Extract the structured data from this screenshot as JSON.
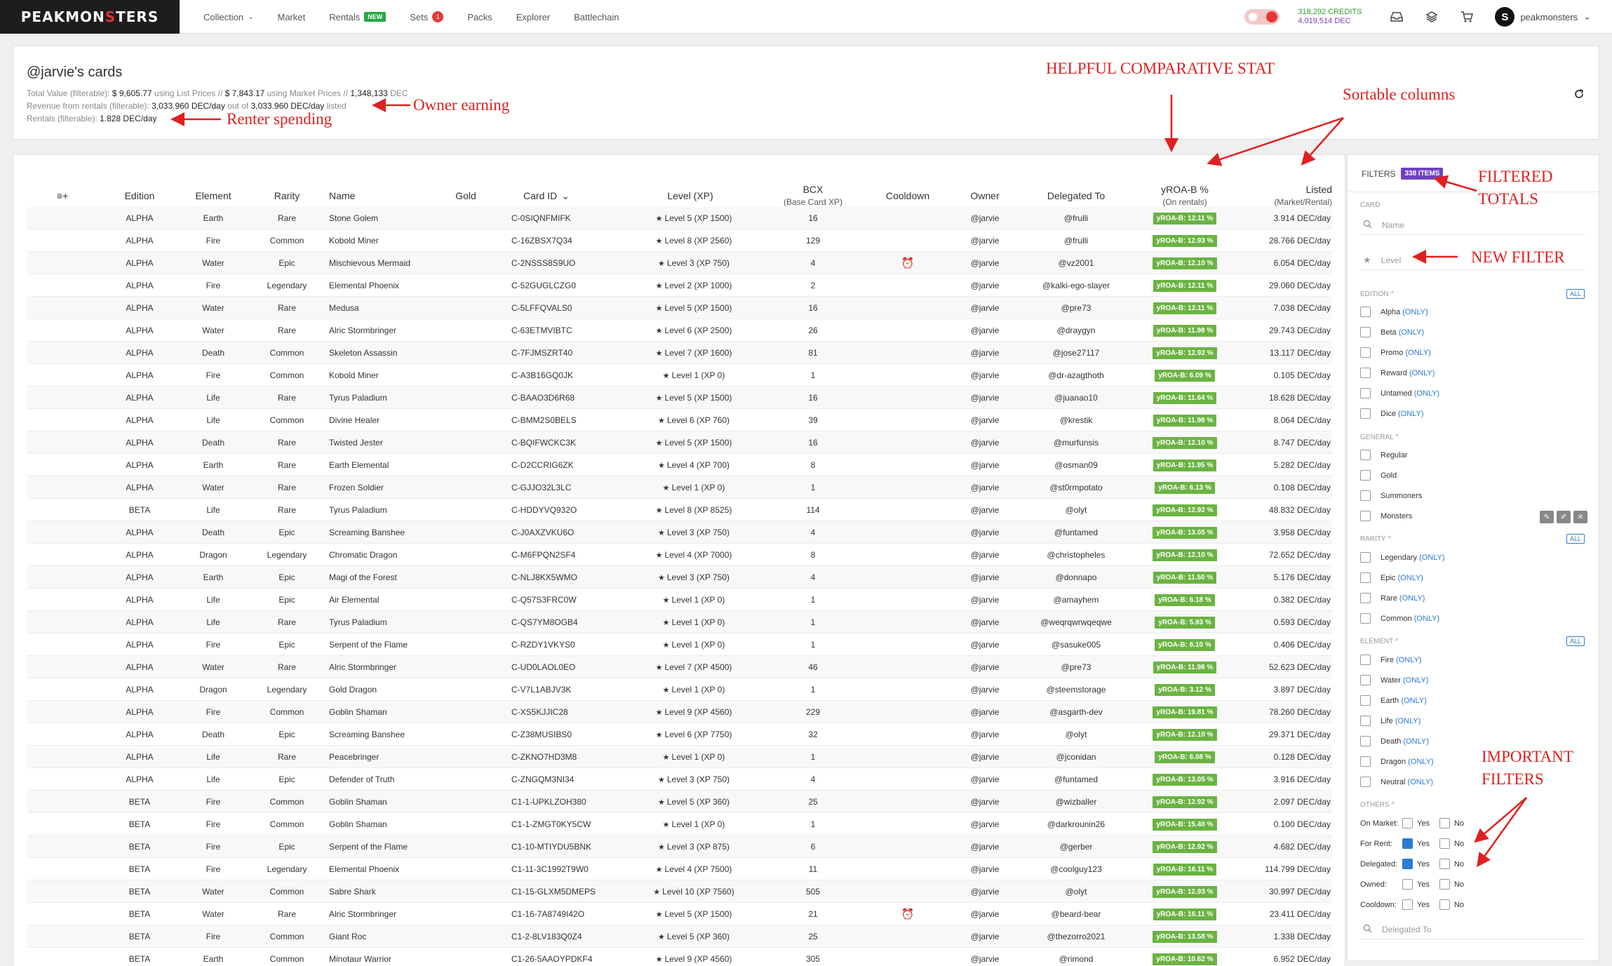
{
  "nav": {
    "logo_left": "PEAKMON",
    "logo_s": "S",
    "logo_right": "TERS",
    "menu": [
      {
        "label": "Collection",
        "caret": "⌄",
        "badge": "",
        "count": ""
      },
      {
        "label": "Market",
        "caret": "",
        "badge": "",
        "count": ""
      },
      {
        "label": "Rentals",
        "caret": "",
        "badge": "NEW",
        "count": ""
      },
      {
        "label": "Sets",
        "caret": "",
        "badge": "",
        "count": "1"
      },
      {
        "label": "Packs",
        "caret": "",
        "badge": "",
        "count": ""
      },
      {
        "label": "Explorer",
        "caret": "",
        "badge": "",
        "count": ""
      },
      {
        "label": "Battlechain",
        "caret": "",
        "badge": "",
        "count": ""
      }
    ],
    "credits": "318,292 CREDITS",
    "dec": "4,019,514 DEC",
    "username": "peakmonsters",
    "user_caret": "⌄",
    "icons": [
      "inbox-icon",
      "layers-icon",
      "cart-icon"
    ]
  },
  "header": {
    "title": "@jarvie's cards",
    "line1": {
      "p1": "Total Value (filterable):",
      "v1": "$ 9,605.77",
      "p2": "using List Prices //",
      "v2": "$ 7,843.17",
      "p3": "using Market Prices //",
      "v3": "1,348,133",
      "p4": "DEC"
    },
    "line2": {
      "p1": "Revenue from rentals (filterable):",
      "v1": "3,033.960 DEC/day",
      "p2": "out of",
      "v2": "3,033.960 DEC/day",
      "p3": "listed"
    },
    "line3": {
      "p1": "Rentals (filterable):",
      "v1": "1.828 DEC/day"
    }
  },
  "annotations": {
    "owner_earning": "Owner earning",
    "renter_spending": "Renter spending",
    "helpful": "HELPFUL COMPARATIVE STAT",
    "sortable": "Sortable columns",
    "filtered_totals_1": "FILTERED",
    "filtered_totals_2": "TOTALS",
    "new_filter": "NEW FILTER",
    "important_1": "IMPORTANT",
    "important_2": "FILTERS"
  },
  "table": {
    "columns": {
      "menu": "≡+",
      "edition": "Edition",
      "element": "Element",
      "rarity": "Rarity",
      "name": "Name",
      "gold": "Gold",
      "card_id": "Card ID",
      "card_id_sort": "⌄",
      "level": "Level (XP)",
      "bcx": "BCX",
      "bcx_sub": "(Base Card XP)",
      "cooldown": "Cooldown",
      "owner": "Owner",
      "delegated": "Delegated To",
      "yroa": "yROA-B %",
      "yroa_sub": "(On rentals)",
      "listed": "Listed",
      "listed_sub": "(Market/Rental)"
    },
    "rows": [
      {
        "edition": "ALPHA",
        "element": "Earth",
        "rarity": "Rare",
        "name": "Stone Golem",
        "id": "C-0SIQNFMIFK",
        "level": "Level 5 (XP 1500)",
        "bcx": "16",
        "cooldown": "",
        "owner": "@jarvie",
        "delegated": "@frulli",
        "roa": "yROA-B: 12.11 %",
        "listed": "3.914 DEC/day"
      },
      {
        "edition": "ALPHA",
        "element": "Fire",
        "rarity": "Common",
        "name": "Kobold Miner",
        "id": "C-16ZBSX7Q34",
        "level": "Level 8 (XP 2560)",
        "bcx": "129",
        "cooldown": "",
        "owner": "@jarvie",
        "delegated": "@frulli",
        "roa": "yROA-B: 12.93 %",
        "listed": "28.766 DEC/day"
      },
      {
        "edition": "ALPHA",
        "element": "Water",
        "rarity": "Epic",
        "name": "Mischievous Mermaid",
        "id": "C-2NSSS8S9UO",
        "level": "Level 3 (XP 750)",
        "bcx": "4",
        "cooldown": "⏰",
        "owner": "@jarvie",
        "delegated": "@vz2001",
        "roa": "yROA-B: 12.10 %",
        "listed": "6.054 DEC/day"
      },
      {
        "edition": "ALPHA",
        "element": "Fire",
        "rarity": "Legendary",
        "name": "Elemental Phoenix",
        "id": "C-52GUGLCZG0",
        "level": "Level 2 (XP 1000)",
        "bcx": "2",
        "cooldown": "",
        "owner": "@jarvie",
        "delegated": "@kalki-ego-slayer",
        "roa": "yROA-B: 12.11 %",
        "listed": "29.060 DEC/day"
      },
      {
        "edition": "ALPHA",
        "element": "Water",
        "rarity": "Rare",
        "name": "Medusa",
        "id": "C-5LFFQVALS0",
        "level": "Level 5 (XP 1500)",
        "bcx": "16",
        "cooldown": "",
        "owner": "@jarvie",
        "delegated": "@pre73",
        "roa": "yROA-B: 12.11 %",
        "listed": "7.038 DEC/day"
      },
      {
        "edition": "ALPHA",
        "element": "Water",
        "rarity": "Rare",
        "name": "Alric Stormbringer",
        "id": "C-63ETMVIBTC",
        "level": "Level 6 (XP 2500)",
        "bcx": "26",
        "cooldown": "",
        "owner": "@jarvie",
        "delegated": "@draygyn",
        "roa": "yROA-B: 11.98 %",
        "listed": "29.743 DEC/day"
      },
      {
        "edition": "ALPHA",
        "element": "Death",
        "rarity": "Common",
        "name": "Skeleton Assassin",
        "id": "C-7FJMSZRT40",
        "level": "Level 7 (XP 1600)",
        "bcx": "81",
        "cooldown": "",
        "owner": "@jarvie",
        "delegated": "@jose27117",
        "roa": "yROA-B: 12.92 %",
        "listed": "13.117 DEC/day"
      },
      {
        "edition": "ALPHA",
        "element": "Fire",
        "rarity": "Common",
        "name": "Kobold Miner",
        "id": "C-A3B16GQ0JK",
        "level": "Level 1 (XP 0)",
        "bcx": "1",
        "cooldown": "",
        "owner": "@jarvie",
        "delegated": "@dr-azagthoth",
        "roa": "yROA-B: 6.09 %",
        "listed": "0.105 DEC/day"
      },
      {
        "edition": "ALPHA",
        "element": "Life",
        "rarity": "Rare",
        "name": "Tyrus Paladium",
        "id": "C-BAAO3D6R68",
        "level": "Level 5 (XP 1500)",
        "bcx": "16",
        "cooldown": "",
        "owner": "@jarvie",
        "delegated": "@juanao10",
        "roa": "yROA-B: 11.64 %",
        "listed": "18.628 DEC/day"
      },
      {
        "edition": "ALPHA",
        "element": "Life",
        "rarity": "Common",
        "name": "Divine Healer",
        "id": "C-BMM2S0BELS",
        "level": "Level 6 (XP 760)",
        "bcx": "39",
        "cooldown": "",
        "owner": "@jarvie",
        "delegated": "@krestik",
        "roa": "yROA-B: 11.98 %",
        "listed": "8.064 DEC/day"
      },
      {
        "edition": "ALPHA",
        "element": "Death",
        "rarity": "Rare",
        "name": "Twisted Jester",
        "id": "C-BQIFWCKC3K",
        "level": "Level 5 (XP 1500)",
        "bcx": "16",
        "cooldown": "",
        "owner": "@jarvie",
        "delegated": "@murfunsis",
        "roa": "yROA-B: 12.10 %",
        "listed": "8.747 DEC/day"
      },
      {
        "edition": "ALPHA",
        "element": "Earth",
        "rarity": "Rare",
        "name": "Earth Elemental",
        "id": "C-D2CCRIG6ZK",
        "level": "Level 4 (XP 700)",
        "bcx": "8",
        "cooldown": "",
        "owner": "@jarvie",
        "delegated": "@osman09",
        "roa": "yROA-B: 11.95 %",
        "listed": "5.282 DEC/day"
      },
      {
        "edition": "ALPHA",
        "element": "Water",
        "rarity": "Rare",
        "name": "Frozen Soldier",
        "id": "C-GJJO32L3LC",
        "level": "Level 1 (XP 0)",
        "bcx": "1",
        "cooldown": "",
        "owner": "@jarvie",
        "delegated": "@st0rmpotato",
        "roa": "yROA-B: 6.13 %",
        "listed": "0.108 DEC/day"
      },
      {
        "edition": "BETA",
        "element": "Life",
        "rarity": "Rare",
        "name": "Tyrus Paladium",
        "id": "C-HDDYVQ932O",
        "level": "Level 8 (XP 8525)",
        "bcx": "114",
        "cooldown": "",
        "owner": "@jarvie",
        "delegated": "@olyt",
        "roa": "yROA-B: 12.92 %",
        "listed": "48.832 DEC/day"
      },
      {
        "edition": "ALPHA",
        "element": "Death",
        "rarity": "Epic",
        "name": "Screaming Banshee",
        "id": "C-J0AXZVKU6O",
        "level": "Level 3 (XP 750)",
        "bcx": "4",
        "cooldown": "",
        "owner": "@jarvie",
        "delegated": "@funtamed",
        "roa": "yROA-B: 13.05 %",
        "listed": "3.958 DEC/day"
      },
      {
        "edition": "ALPHA",
        "element": "Dragon",
        "rarity": "Legendary",
        "name": "Chromatic Dragon",
        "id": "C-M6FPQN2SF4",
        "level": "Level 4 (XP 7000)",
        "bcx": "8",
        "cooldown": "",
        "owner": "@jarvie",
        "delegated": "@christopheles",
        "roa": "yROA-B: 12.10 %",
        "listed": "72.652 DEC/day"
      },
      {
        "edition": "ALPHA",
        "element": "Earth",
        "rarity": "Epic",
        "name": "Magi of the Forest",
        "id": "C-NLJ8KX5WMO",
        "level": "Level 3 (XP 750)",
        "bcx": "4",
        "cooldown": "",
        "owner": "@jarvie",
        "delegated": "@donnapo",
        "roa": "yROA-B: 11.50 %",
        "listed": "5.176 DEC/day"
      },
      {
        "edition": "ALPHA",
        "element": "Life",
        "rarity": "Epic",
        "name": "Air Elemental",
        "id": "C-Q57S3FRC0W",
        "level": "Level 1 (XP 0)",
        "bcx": "1",
        "cooldown": "",
        "owner": "@jarvie",
        "delegated": "@amayhem",
        "roa": "yROA-B: 6.18 %",
        "listed": "0.382 DEC/day"
      },
      {
        "edition": "ALPHA",
        "element": "Life",
        "rarity": "Rare",
        "name": "Tyrus Paladium",
        "id": "C-QS7YM8OGB4",
        "level": "Level 1 (XP 0)",
        "bcx": "1",
        "cooldown": "",
        "owner": "@jarvie",
        "delegated": "@weqrqwrwqeqwe",
        "roa": "yROA-B: 5.93 %",
        "listed": "0.593 DEC/day"
      },
      {
        "edition": "ALPHA",
        "element": "Fire",
        "rarity": "Epic",
        "name": "Serpent of the Flame",
        "id": "C-RZDY1VKYS0",
        "level": "Level 1 (XP 0)",
        "bcx": "1",
        "cooldown": "",
        "owner": "@jarvie",
        "delegated": "@sasuke005",
        "roa": "yROA-B: 6.10 %",
        "listed": "0.406 DEC/day"
      },
      {
        "edition": "ALPHA",
        "element": "Water",
        "rarity": "Rare",
        "name": "Alric Stormbringer",
        "id": "C-UD0LAOL0EO",
        "level": "Level 7 (XP 4500)",
        "bcx": "46",
        "cooldown": "",
        "owner": "@jarvie",
        "delegated": "@pre73",
        "roa": "yROA-B: 11.98 %",
        "listed": "52.623 DEC/day"
      },
      {
        "edition": "ALPHA",
        "element": "Dragon",
        "rarity": "Legendary",
        "name": "Gold Dragon",
        "id": "C-V7L1ABJV3K",
        "level": "Level 1 (XP 0)",
        "bcx": "1",
        "cooldown": "",
        "owner": "@jarvie",
        "delegated": "@steemstorage",
        "roa": "yROA-B: 3.12 %",
        "listed": "3.897 DEC/day"
      },
      {
        "edition": "ALPHA",
        "element": "Fire",
        "rarity": "Common",
        "name": "Goblin Shaman",
        "id": "C-XS5KJJIC28",
        "level": "Level 9 (XP 4560)",
        "bcx": "229",
        "cooldown": "",
        "owner": "@jarvie",
        "delegated": "@asgarth-dev",
        "roa": "yROA-B: 19.81 %",
        "listed": "78.260 DEC/day"
      },
      {
        "edition": "ALPHA",
        "element": "Death",
        "rarity": "Epic",
        "name": "Screaming Banshee",
        "id": "C-Z38MUSIBS0",
        "level": "Level 6 (XP 7750)",
        "bcx": "32",
        "cooldown": "",
        "owner": "@jarvie",
        "delegated": "@olyt",
        "roa": "yROA-B: 12.10 %",
        "listed": "29.371 DEC/day"
      },
      {
        "edition": "ALPHA",
        "element": "Life",
        "rarity": "Rare",
        "name": "Peacebringer",
        "id": "C-ZKNO7HD3M8",
        "level": "Level 1 (XP 0)",
        "bcx": "1",
        "cooldown": "",
        "owner": "@jarvie",
        "delegated": "@jconidan",
        "roa": "yROA-B: 6.08 %",
        "listed": "0.128 DEC/day"
      },
      {
        "edition": "ALPHA",
        "element": "Life",
        "rarity": "Epic",
        "name": "Defender of Truth",
        "id": "C-ZNGQM3NI34",
        "level": "Level 3 (XP 750)",
        "bcx": "4",
        "cooldown": "",
        "owner": "@jarvie",
        "delegated": "@funtamed",
        "roa": "yROA-B: 13.05 %",
        "listed": "3.916 DEC/day"
      },
      {
        "edition": "BETA",
        "element": "Fire",
        "rarity": "Common",
        "name": "Goblin Shaman",
        "id": "C1-1-UPKLZOH380",
        "level": "Level 5 (XP 360)",
        "bcx": "25",
        "cooldown": "",
        "owner": "@jarvie",
        "delegated": "@wizballer",
        "roa": "yROA-B: 12.92 %",
        "listed": "2.097 DEC/day"
      },
      {
        "edition": "BETA",
        "element": "Fire",
        "rarity": "Common",
        "name": "Goblin Shaman",
        "id": "C1-1-ZMGT0KY5CW",
        "level": "Level 1 (XP 0)",
        "bcx": "1",
        "cooldown": "",
        "owner": "@jarvie",
        "delegated": "@darkrounin26",
        "roa": "yROA-B: 15.40 %",
        "listed": "0.100 DEC/day"
      },
      {
        "edition": "BETA",
        "element": "Fire",
        "rarity": "Epic",
        "name": "Serpent of the Flame",
        "id": "C1-10-MTIYDU5BNK",
        "level": "Level 3 (XP 875)",
        "bcx": "6",
        "cooldown": "",
        "owner": "@jarvie",
        "delegated": "@gerber",
        "roa": "yROA-B: 12.92 %",
        "listed": "4.682 DEC/day"
      },
      {
        "edition": "BETA",
        "element": "Fire",
        "rarity": "Legendary",
        "name": "Elemental Phoenix",
        "id": "C1-11-3C1992T9W0",
        "level": "Level 4 (XP 7500)",
        "bcx": "11",
        "cooldown": "",
        "owner": "@jarvie",
        "delegated": "@coolguy123",
        "roa": "yROA-B: 16.11 %",
        "listed": "114.799 DEC/day"
      },
      {
        "edition": "BETA",
        "element": "Water",
        "rarity": "Common",
        "name": "Sabre Shark",
        "id": "C1-15-GLXM5DMEPS",
        "level": "Level 10 (XP 7560)",
        "bcx": "505",
        "cooldown": "",
        "owner": "@jarvie",
        "delegated": "@olyt",
        "roa": "yROA-B: 12.93 %",
        "listed": "30.997 DEC/day"
      },
      {
        "edition": "BETA",
        "element": "Water",
        "rarity": "Rare",
        "name": "Alric Stormbringer",
        "id": "C1-16-7A8749I42O",
        "level": "Level 5 (XP 1500)",
        "bcx": "21",
        "cooldown": "⏰",
        "owner": "@jarvie",
        "delegated": "@beard-bear",
        "roa": "yROA-B: 16.11 %",
        "listed": "23.411 DEC/day"
      },
      {
        "edition": "BETA",
        "element": "Fire",
        "rarity": "Common",
        "name": "Giant Roc",
        "id": "C1-2-8LV183Q0Z4",
        "level": "Level 5 (XP 360)",
        "bcx": "25",
        "cooldown": "",
        "owner": "@jarvie",
        "delegated": "@thezorro2021",
        "roa": "yROA-B: 13.58 %",
        "listed": "1.338 DEC/day"
      },
      {
        "edition": "BETA",
        "element": "Earth",
        "rarity": "Common",
        "name": "Minotaur Warrior",
        "id": "C1-26-5AAOYPDKF4",
        "level": "Level 9 (XP 4560)",
        "bcx": "305",
        "cooldown": "",
        "owner": "@jarvie",
        "delegated": "@rimond",
        "roa": "yROA-B: 10.62 %",
        "listed": "6.952 DEC/day"
      }
    ]
  },
  "filters": {
    "title": "FILTERS",
    "items": "338 ITEMS",
    "card_label": "CARD",
    "name_placeholder": "Name",
    "level_placeholder": "Level",
    "edition_label": "EDITION",
    "general_label": "GENERAL",
    "rarity_label": "RARITY",
    "element_label": "ELEMENT",
    "others_label": "OTHERS",
    "collapse": "^",
    "all": "ALL",
    "only": "(ONLY)",
    "editions": [
      "Alpha",
      "Beta",
      "Promo",
      "Reward",
      "Untamed",
      "Dice"
    ],
    "general": [
      "Regular",
      "Gold",
      "Summoners",
      "Monsters"
    ],
    "rarities": [
      "Legendary",
      "Epic",
      "Rare",
      "Common"
    ],
    "elements": [
      "Fire",
      "Water",
      "Earth",
      "Life",
      "Death",
      "Dragon",
      "Neutral"
    ],
    "others": [
      {
        "label": "On Market:",
        "yes": "Yes",
        "no": "No",
        "yes_on": false,
        "no_on": false
      },
      {
        "label": "For Rent:",
        "yes": "Yes",
        "no": "No",
        "yes_on": true,
        "no_on": false
      },
      {
        "label": "Delegated:",
        "yes": "Yes",
        "no": "No",
        "yes_on": true,
        "no_on": false
      },
      {
        "label": "Owned:",
        "yes": "Yes",
        "no": "No",
        "yes_on": false,
        "no_on": false
      },
      {
        "label": "Cooldown:",
        "yes": "Yes",
        "no": "No",
        "yes_on": false,
        "no_on": false
      }
    ],
    "delegated_placeholder": "Delegated To"
  }
}
